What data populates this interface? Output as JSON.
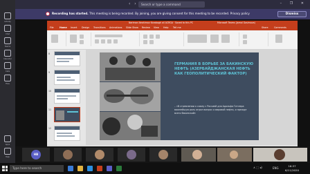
{
  "teams": {
    "search_placeholder": "Search or type a command",
    "nav_arrows": "‹ ›",
    "window_controls": "– ❐ ✕",
    "rail_items": [
      "Activity",
      "Chat",
      "Teams",
      "Calendar",
      "Calls",
      "Files",
      "Apps",
      "Help"
    ]
  },
  "banner": {
    "bold_text": "Recording has started.",
    "text": " This meeting is being recorded. By joining, you are giving consent for this meeting to be recorded.",
    "link": "Privacy policy",
    "dismiss_label": "Dismiss"
  },
  "ppt": {
    "title": "Nariman Ibrahimov Karabagh oil ACRGA · Saved to this PC",
    "user": "Microsoft Teams (Jamal Gasimova)",
    "tabs": [
      "File",
      "Home",
      "Insert",
      "Design",
      "Transitions",
      "Animations",
      "Slide Show",
      "Review",
      "View",
      "Help",
      "Tell me"
    ],
    "share": "Share",
    "comments": "Comments",
    "slide_numbers": [
      "8",
      "9",
      "10",
      "11",
      "12"
    ],
    "slide_title": "ГЕРМАНИЯ В БОРЬБЕ ЗА БАКИНСКУЮ НЕФТЬ (АЗЕРБАЙДЖАНСКАЯ НЕФТЬ КАК ГЕОПОЛИТИЧЕСКИЙ ФАКТОР)",
    "slide_bullet": "– «В стремлении к союзу с Россией для Адольфа Гитлера важнейшую роль играл вопрос о мировой нефти, и прежде всего бакинской»",
    "status_left": "Slide 11 of 21 · English (United States)",
    "notes": "Notes",
    "zoom": "80%"
  },
  "participants": {
    "initials_1": "HB"
  },
  "taskbar": {
    "search_placeholder": "Type here to search",
    "tray": "∧ ⬚ ◂)",
    "lang": "ENG",
    "time": "16:37",
    "date": "6/11/2020"
  },
  "colors": {
    "teams_banner": "#3d3a67",
    "ppt_accent": "#c43e1c",
    "slide_bg": "#3e4c5f",
    "slide_title": "#5fc5d8"
  }
}
